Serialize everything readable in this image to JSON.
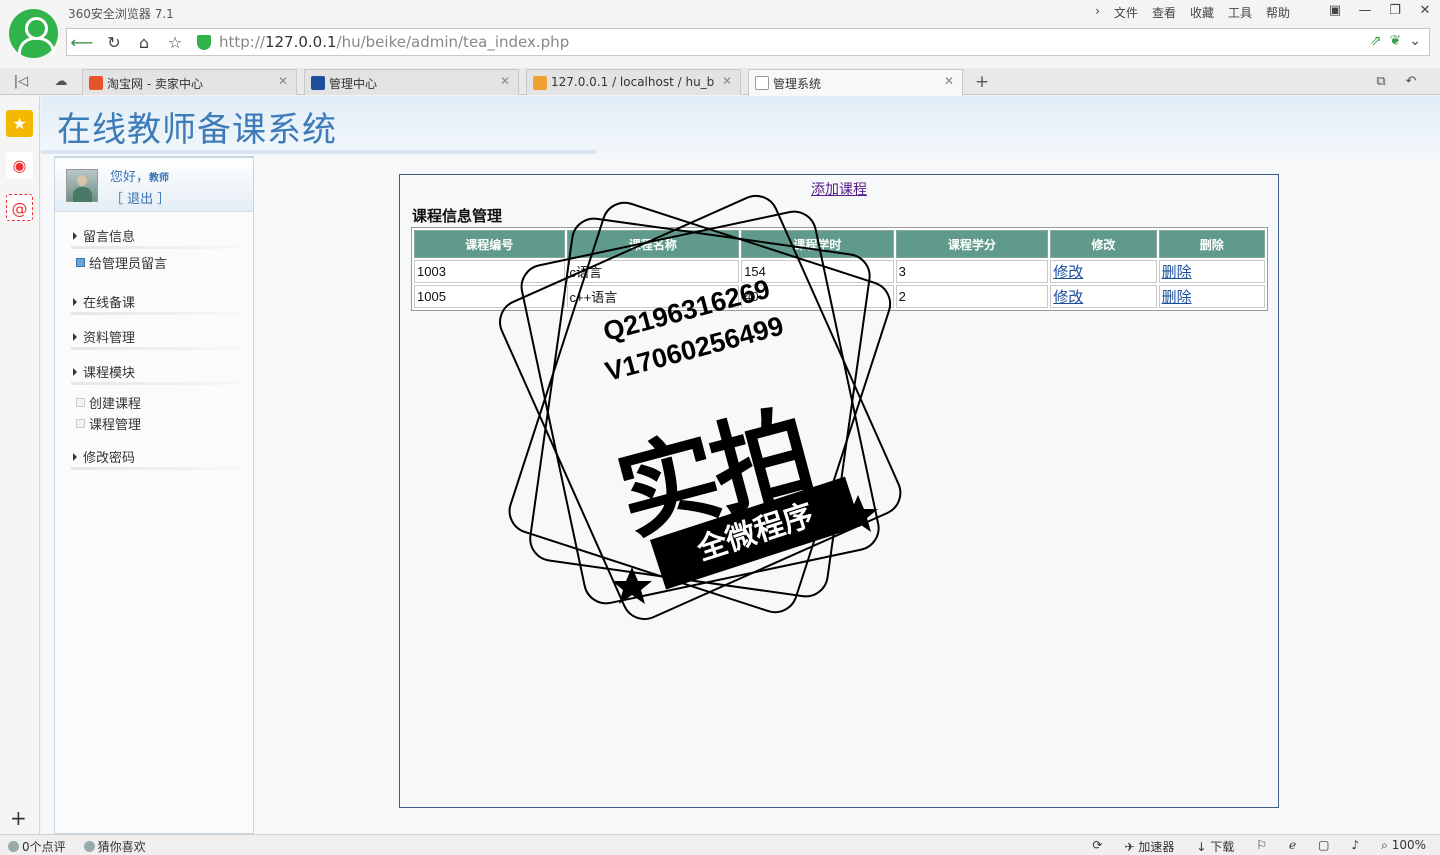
{
  "browser": {
    "app_title": "360安全浏览器 7.1",
    "menu": [
      "文件",
      "查看",
      "收藏",
      "工具",
      "帮助"
    ],
    "window_controls": [
      "▣",
      "—",
      "❐",
      "✕"
    ],
    "url_prefix": "http://",
    "url_host": "127.0.0.1",
    "url_path": "/hu/beike/admin/tea_index.php",
    "tabs": [
      {
        "label": "淘宝网 - 卖家中心",
        "favicon_color": "#e8542a"
      },
      {
        "label": "管理中心",
        "favicon_color": "#1e4f9c"
      },
      {
        "label": "127.0.0.1 / localhost / hu_b",
        "favicon_color": "#f0a030"
      },
      {
        "label": "管理系统",
        "favicon_color": "#dddddd"
      }
    ],
    "tab_close": "✕",
    "tab_add": "+"
  },
  "site": {
    "title": "在线教师备课系统"
  },
  "user": {
    "greeting": "您好，",
    "role": "教师",
    "logout": "［ 退出 ］"
  },
  "nav": {
    "msg": "留言信息",
    "msg_admin": "给管理员留言",
    "prep": "在线备课",
    "materials": "资料管理",
    "course_module": "课程模块",
    "create_course": "创建课程",
    "course_manage": "课程管理",
    "change_pwd": "修改密码"
  },
  "content": {
    "add_link": "添加课程",
    "section_title": "课程信息管理",
    "columns": [
      "课程编号",
      "课程名称",
      "课程学时",
      "课程学分",
      "修改",
      "删除"
    ],
    "rows": [
      {
        "id": "1003",
        "name": "c语言",
        "hours": "154",
        "credits": "3",
        "edit": "修改",
        "delete": "删除"
      },
      {
        "id": "1005",
        "name": "c++语言",
        "hours": "40",
        "credits": "2",
        "edit": "修改",
        "delete": "删除"
      }
    ]
  },
  "watermark": {
    "line1": "Q2196316269",
    "line2": "V17060256499",
    "big": "实拍",
    "ribbon": "全微程序"
  },
  "status": {
    "comments": "0个点评",
    "guess": "猜你喜欢",
    "accelerator": "加速器",
    "download": "下载",
    "zoom": "100%"
  }
}
